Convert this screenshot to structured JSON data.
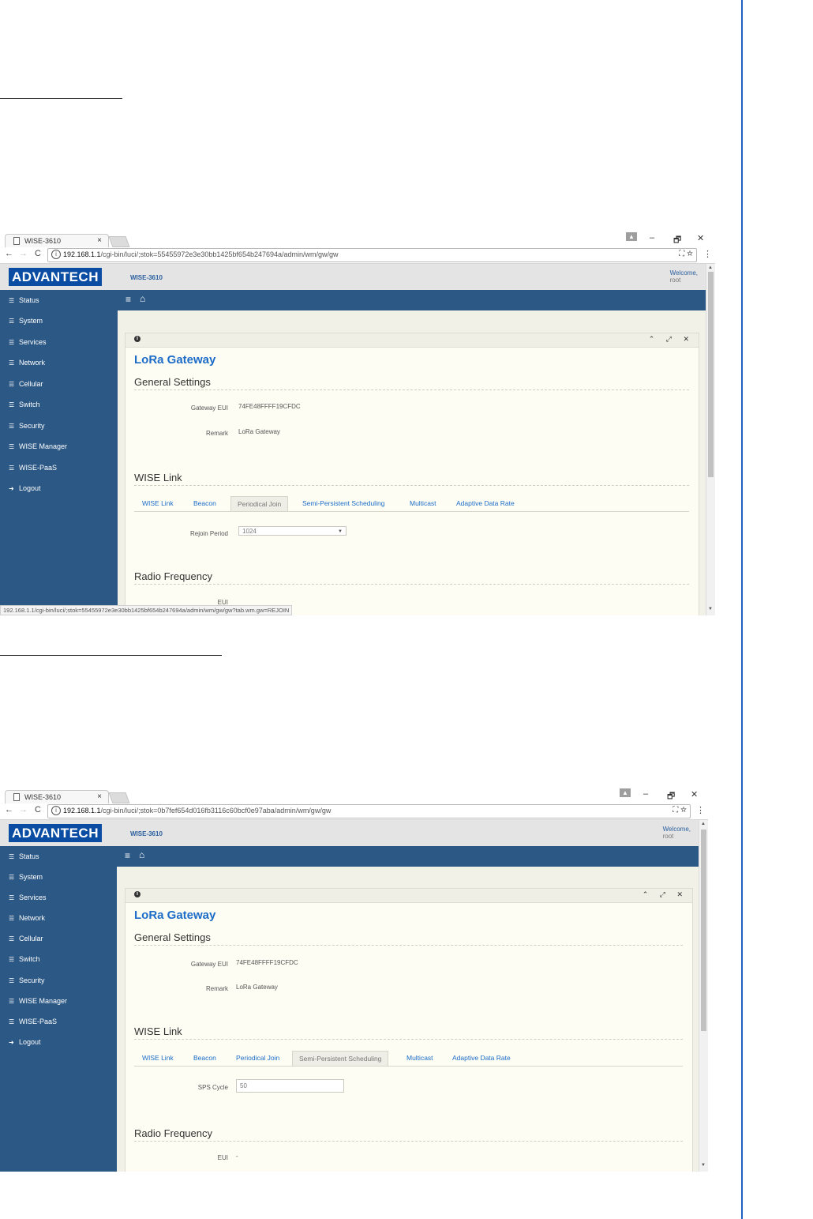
{
  "browser": {
    "tab_title": "WISE-3610",
    "tab_close": "×",
    "minimize": "–",
    "restore": "🗗",
    "close": "✕",
    "back": "←",
    "forward": "→",
    "reload": "C",
    "info": "i",
    "menu": "⋮"
  },
  "shot1": {
    "url_host": "192.168.1.1",
    "url_path": "/cgi-bin/luci/;stok=55455972e3e30bb1425bf654b247694a/admin/wm/gw/gw",
    "status_url": "192.168.1.1/cgi-bin/luci/;stok=55455972e3e30bb1425bf654b247694a/admin/wm/gw/gw?tab.wm.gw=REJOIN",
    "field_label": "Rejoin Period",
    "field_value": "1024",
    "next_label": "EUI"
  },
  "shot2": {
    "url_host": "192.168.1.1",
    "url_path": "/cgi-bin/luci/;stok=0b7fef654d016fb3116c60bcf0e97aba/admin/wm/gw/gw",
    "field_label": "SPS Cycle",
    "field_value": "50",
    "next_label": "EUI",
    "next_value": "-"
  },
  "app": {
    "logo": "ADVANTECH",
    "model": "WISE-3610",
    "welcome": "Welcome,",
    "user": "root",
    "menu_icon": "≡",
    "home_icon": "⌂"
  },
  "sidebar": [
    {
      "label": "Status"
    },
    {
      "label": "System"
    },
    {
      "label": "Services"
    },
    {
      "label": "Network"
    },
    {
      "label": "Cellular"
    },
    {
      "label": "Switch"
    },
    {
      "label": "Security"
    },
    {
      "label": "WISE Manager"
    },
    {
      "label": "WISE-PaaS"
    },
    {
      "label": "Logout"
    }
  ],
  "panel": {
    "title": "LoRa Gateway",
    "general_settings": "General Settings",
    "gateway_eui_label": "Gateway EUI",
    "gateway_eui_value": "74FE48FFFF19CFDC",
    "remark_label": "Remark",
    "remark_value": "LoRa Gateway",
    "wise_link": "WISE Link",
    "radio_frequency": "Radio Frequency"
  },
  "subtabs": [
    "WISE Link",
    "Beacon",
    "Periodical Join",
    "Semi-Persistent Scheduling",
    "Multicast",
    "Adaptive Data Rate"
  ],
  "colors": {
    "accent": "#1c6cc8",
    "sidebar": "#2c5885",
    "brand": "#0b4da3"
  }
}
